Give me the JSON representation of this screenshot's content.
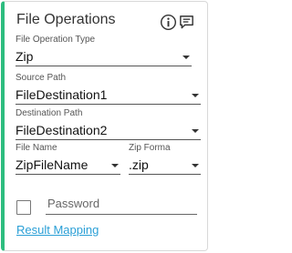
{
  "title": "File Operations",
  "icons": {
    "info": "info-icon",
    "comment": "comment-icon"
  },
  "fields": {
    "operation_type": {
      "label": "File Operation Type",
      "value": "Zip"
    },
    "source_path": {
      "label": "Source Path",
      "value": "FileDestination1"
    },
    "destination_path": {
      "label": "Destination Path",
      "value": "FileDestination2"
    },
    "file_name": {
      "label": "File Name",
      "value": "ZipFileName"
    },
    "zip_format": {
      "label": "Zip Forma",
      "value": ".zip"
    }
  },
  "password": {
    "placeholder": "Password",
    "value": ""
  },
  "result_mapping": "Result Mapping",
  "colors": {
    "accent": "#2dbd7f",
    "link": "#2a9fd6"
  }
}
